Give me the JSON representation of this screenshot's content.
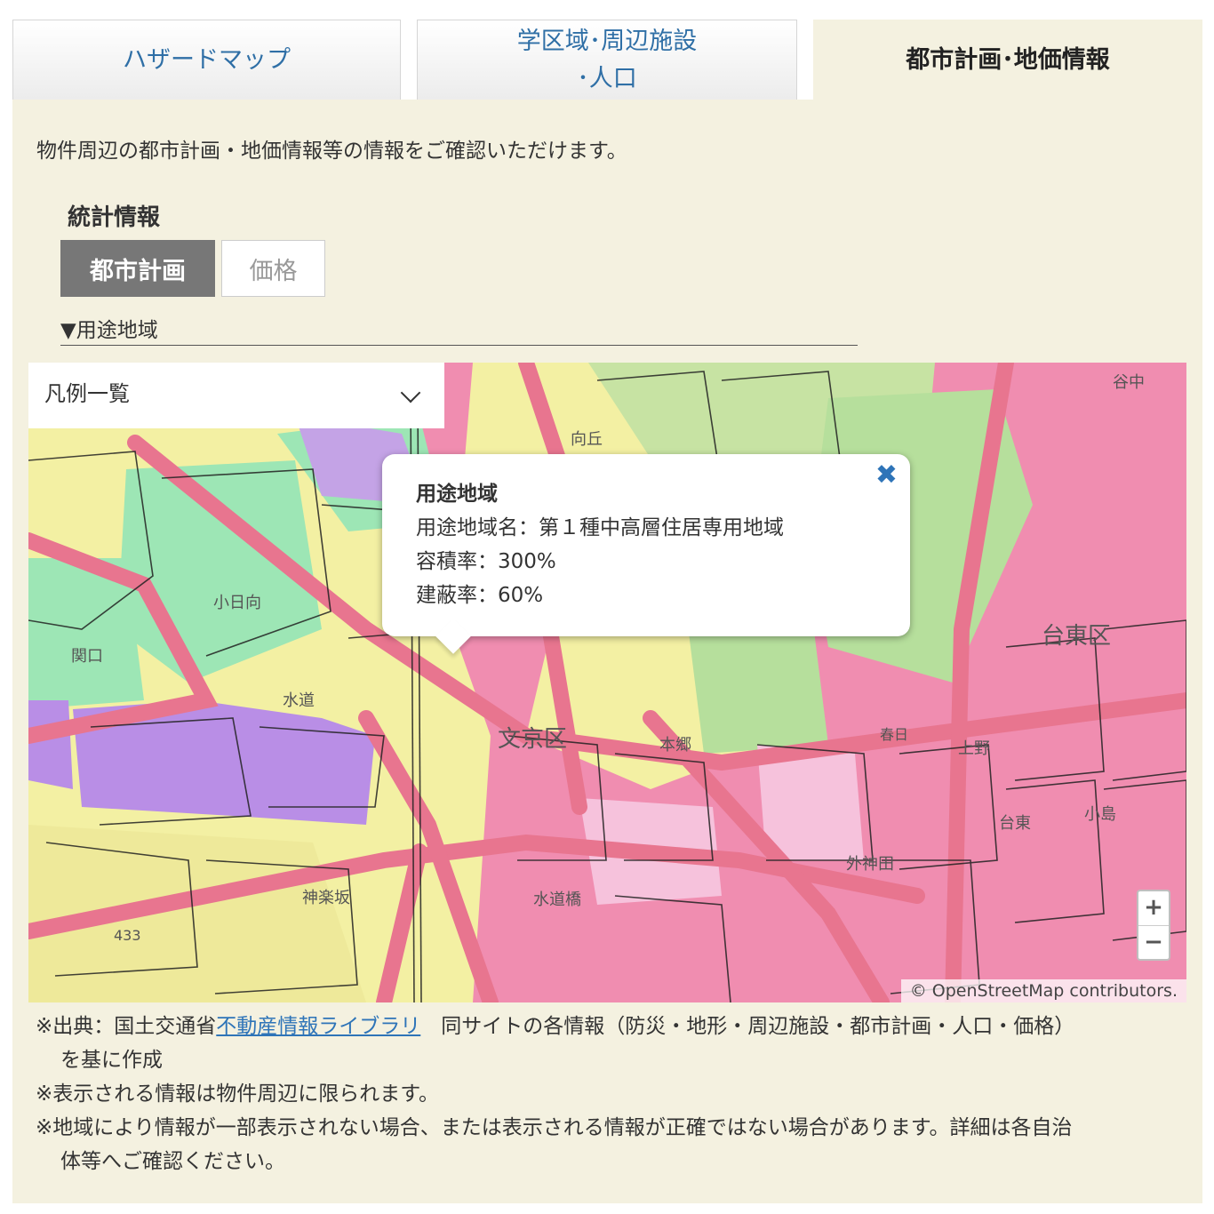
{
  "tabs": {
    "hazard": "ハザードマップ",
    "school_line1": "学区域･周辺施設",
    "school_line2": "･人口",
    "city": "都市計画･地価情報"
  },
  "intro": "物件周辺の都市計画・地価情報等の情報をご確認いただけます。",
  "stats": {
    "title": "統計情報",
    "btn_city": "都市計画",
    "btn_price": "価格"
  },
  "section_title": "▼用途地域",
  "map": {
    "legend_label": "凡例一覧",
    "popup": {
      "title": "用途地域",
      "line1": "用途地域名：第１種中高層住居専用地域",
      "line2": "容積率：300%",
      "line3": "建蔽率：60%"
    },
    "zoom_in": "+",
    "zoom_out": "−",
    "attribution": "© OpenStreetMap contributors.",
    "labels": {
      "bunkyo": "文京区",
      "taito": "台東区",
      "kobinata": "小日向",
      "suido": "水道",
      "sekiguchi": "関口",
      "kagurazaka": "神楽坂",
      "hongo": "本郷",
      "ueno": "上野",
      "taito_town": "台東",
      "kojima": "小島",
      "sotokanda": "外神田",
      "suidobashi": "水道橋",
      "kasuga": "春日",
      "mukogaoka": "向丘",
      "yanaka": "谷中",
      "r433": "433"
    }
  },
  "notes": {
    "n1_pre": "※出典：国土交通省",
    "n1_link": "不動産情報ライブラリ",
    "n1_post": "　同サイトの各情報（防災・地形・周辺施設・都市計画・人口・価格）",
    "n1_cont": "を基に作成",
    "n2": "※表示される情報は物件周辺に限られます。",
    "n3": "※地域により情報が一部表示されない場合、または表示される情報が正確ではない場合があります。詳細は各自治",
    "n3_cont": "体等へご確認ください。"
  },
  "colors": {
    "panel_bg": "#f4f1e0",
    "commercial": "#f08db0",
    "residential_mid": "#f3f0a3",
    "residential_low": "#9de6b5",
    "industrial": "#b98ee6",
    "park": "#b6df9c",
    "road": "#e8758f",
    "link": "#2e74b8"
  }
}
